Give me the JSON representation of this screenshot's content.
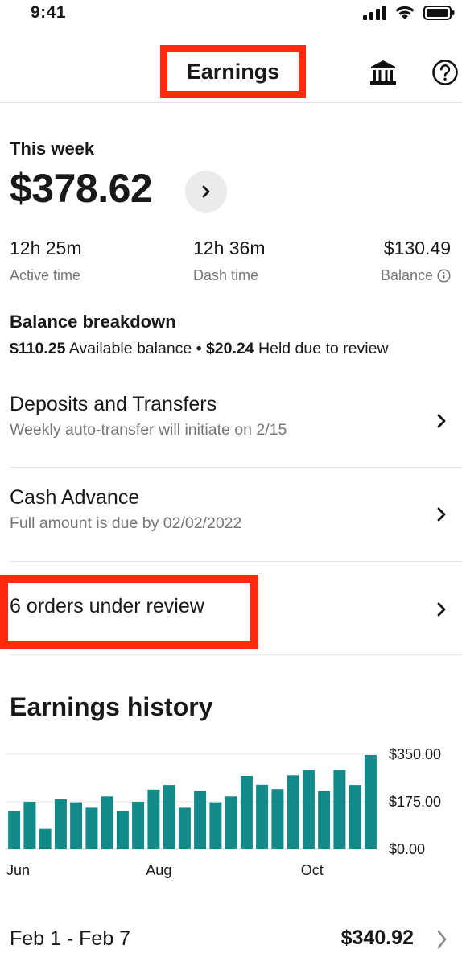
{
  "status_bar": {
    "time": "9:41"
  },
  "header": {
    "title": "Earnings"
  },
  "week": {
    "label": "This week",
    "amount": "$378.62",
    "stats": [
      {
        "value": "12h 25m",
        "label": "Active time"
      },
      {
        "value": "12h 36m",
        "label": "Dash time"
      },
      {
        "value": "$130.49",
        "label": "Balance"
      }
    ]
  },
  "balance_breakdown": {
    "title": "Balance breakdown",
    "available_amount": "$110.25",
    "available_label": "Available balance",
    "separator": "•",
    "held_amount": "$20.24",
    "held_label": "Held due to review"
  },
  "rows": [
    {
      "title": "Deposits and Transfers",
      "subtitle": "Weekly auto-transfer will initiate on 2/15"
    },
    {
      "title": "Cash Advance",
      "subtitle": "Full amount is due by 02/02/2022"
    },
    {
      "title": "6 orders under review"
    }
  ],
  "earnings_history": {
    "title": "Earnings history"
  },
  "chart_data": {
    "type": "bar",
    "title": "",
    "xlabel": "",
    "ylabel": "",
    "ylim": [
      0,
      350
    ],
    "y_ticks": [
      "$350.00",
      "$175.00",
      "$0.00"
    ],
    "x_tick_labels": [
      {
        "label": "Jun",
        "index": 0
      },
      {
        "label": "Aug",
        "index": 9
      },
      {
        "label": "Oct",
        "index": 19
      }
    ],
    "values": [
      140,
      175,
      75,
      185,
      173,
      153,
      195,
      140,
      175,
      220,
      237,
      153,
      215,
      173,
      195,
      270,
      238,
      222,
      272,
      292,
      215,
      292,
      237,
      347
    ],
    "color": "#138a8a",
    "grid": true
  },
  "weekly_summary": {
    "date_range": "Feb 1 - Feb 7",
    "amount": "$340.92"
  },
  "colors": {
    "accent": "#138a8a",
    "highlight": "#ff2a0e",
    "muted": "#767676"
  }
}
